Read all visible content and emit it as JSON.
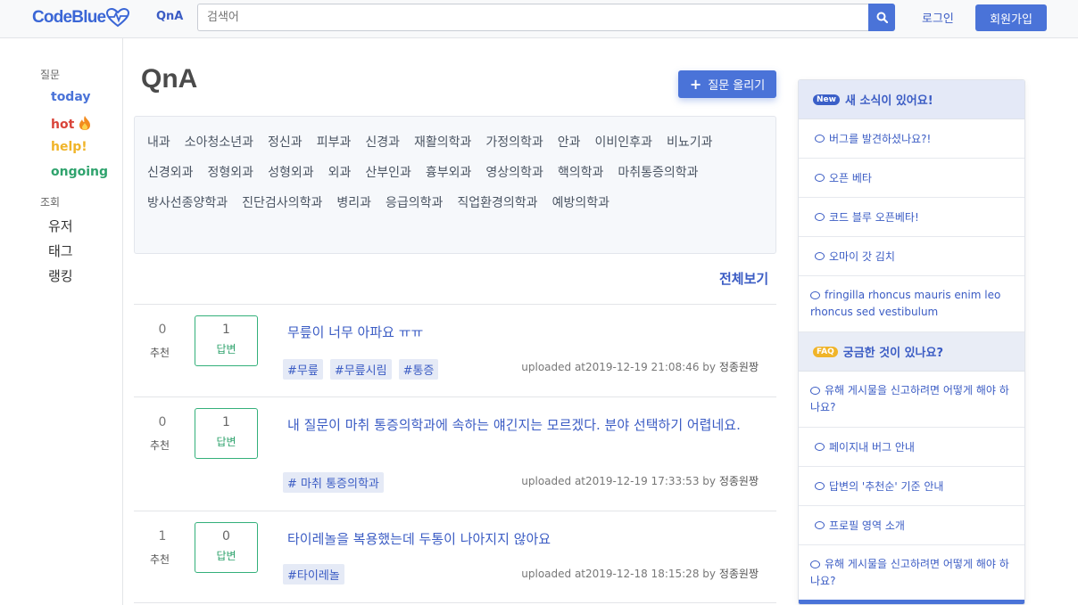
{
  "header": {
    "logo_text": "CodeBlue",
    "nav_qna": "QnA",
    "search_placeholder": "검색어",
    "login_label": "로그인",
    "signup_label": "회원가입"
  },
  "sidebar": {
    "question_section": "질문",
    "filters": [
      {
        "label": "today",
        "color": "#4a73d8"
      },
      {
        "label": "hot",
        "color": "#d9443a"
      },
      {
        "label": "help!",
        "color": "#f0b429"
      },
      {
        "label": "ongoing",
        "color": "#2fa36d"
      }
    ],
    "browse_section": "조회",
    "browse_items": [
      "유저",
      "태그",
      "랭킹"
    ]
  },
  "main": {
    "title": "QnA",
    "ask_button": "질문 올리기",
    "departments": [
      "내과",
      "소아청소년과",
      "정신과",
      "피부과",
      "신경과",
      "재활의학과",
      "가정의학과",
      "안과",
      "이비인후과",
      "비뇨기과",
      "신경외과",
      "정형외과",
      "성형외과",
      "외과",
      "산부인과",
      "흉부외과",
      "영상의학과",
      "핵의학과",
      "마취통증의학과",
      "방사선종양학과",
      "진단검사의학과",
      "병리과",
      "응급의학과",
      "직업환경의학과",
      "예방의학과"
    ],
    "view_all": "전체보기",
    "vote_label": "추천",
    "answer_label": "답변",
    "questions": [
      {
        "votes": "0",
        "answers": "1",
        "title": "무릎이 너무 아파요 ㅠㅠ",
        "tags": [
          "#무릎",
          "#무릎시림",
          "#통증"
        ],
        "uploaded": "uploaded at2019-12-19 21:08:46 by",
        "author": "정종원짱"
      },
      {
        "votes": "0",
        "answers": "1",
        "title": "내 질문이 마취 통증의학과에 속하는 얘긴지는 모르겠다. 분야 선택하기 어렵네요.",
        "tags": [
          "# 마취 통증의학과"
        ],
        "uploaded": "uploaded at2019-12-19 17:33:53 by",
        "author": "정종원짱"
      },
      {
        "votes": "1",
        "answers": "0",
        "title": "타이레놀을 복용했는데 두통이 나아지지 않아요",
        "tags": [
          "#타이레놀"
        ],
        "uploaded": "uploaded at2019-12-18 18:15:28 by",
        "author": "정종원짱"
      }
    ]
  },
  "right_panel": {
    "news_badge": "New",
    "news_title": "새 소식이 있어요!",
    "news_items": [
      "버그를 발견하셨나요?!",
      "오픈 베타",
      "코드 블루 오픈베타!",
      "오마이 갓 김치",
      "fringilla rhoncus mauris enim leo rhoncus sed vestibulum"
    ],
    "faq_badge": "FAQ",
    "faq_title": "궁금한 것이 있나요?",
    "faq_items": [
      "유해 게시물을 신고하려면 어떻게 해야 하나요?",
      "페이지내 버그 안내",
      "답변의 '추천순' 기준 안내",
      "프로필 영역 소개",
      "유해 게시물을 신고하려면 어떻게 해야 하나요?"
    ]
  }
}
